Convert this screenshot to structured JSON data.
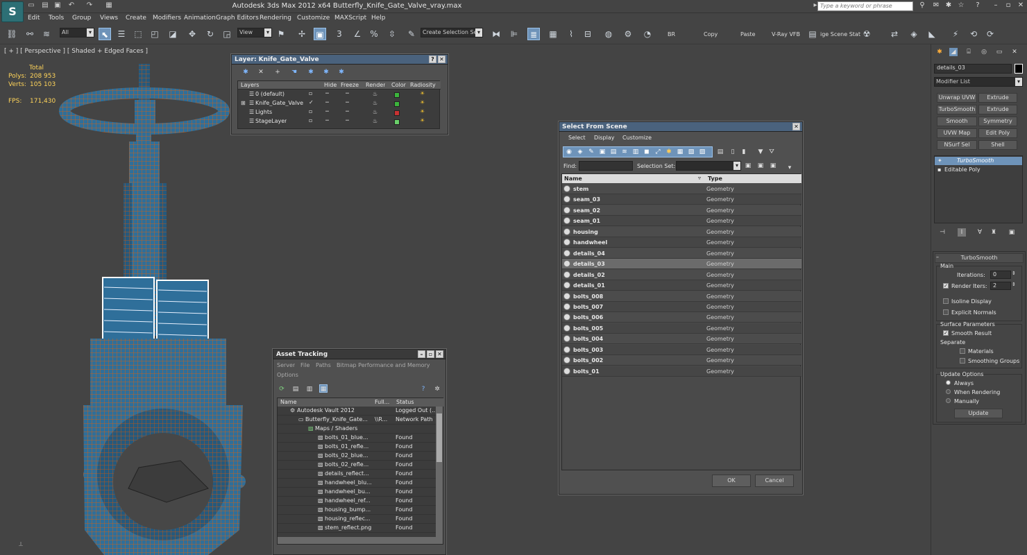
{
  "app": {
    "title": "Autodesk 3ds Max  2012 x64     Butterfly_Knife_Gate_Valve_vray.max",
    "search_placeholder": "Type a keyword or phrase",
    "logo": "S"
  },
  "menu": [
    "Edit",
    "Tools",
    "Group",
    "Views",
    "Create",
    "Modifiers",
    "Animation",
    "Graph Editors",
    "Rendering",
    "Customize",
    "MAXScript",
    "Help"
  ],
  "toolbar": {
    "filter": "All",
    "view": "View",
    "snap_labels": [
      "3",
      "%"
    ],
    "selection_set": "Create Selection Se",
    "text_buttons": [
      "BR",
      "Copy",
      "Paste",
      "V-Ray VFB",
      "ige Scene Stat"
    ]
  },
  "viewport": {
    "label": "[ + ] [ Perspective ] [ Shaded + Edged Faces ]",
    "stats": {
      "total": "Total",
      "polys_label": "Polys:",
      "polys": "208 953",
      "verts_label": "Verts:",
      "verts": "105 103",
      "fps_label": "FPS:",
      "fps": "171,430"
    }
  },
  "layer_dialog": {
    "title": "Layer: Knife_Gate_Valve",
    "columns": [
      "Layers",
      "Hide",
      "Freeze",
      "Render",
      "Color",
      "Radiosity"
    ],
    "rows": [
      {
        "name": "0 (default)",
        "color": "#3cb43c"
      },
      {
        "name": "Knife_Gate_Valve",
        "color": "#3cb43c"
      },
      {
        "name": "Lights",
        "color": "#c83232"
      },
      {
        "name": "StageLayer",
        "color": "#6ad06a"
      }
    ]
  },
  "asset_tracking": {
    "title": "Asset Tracking",
    "menu": [
      "Server",
      "File",
      "Paths",
      "Bitmap Performance and Memory"
    ],
    "menu2": "Options",
    "columns": [
      "Name",
      "Full...",
      "Status"
    ],
    "rows": [
      {
        "name": "Autodesk Vault 2012",
        "full": "",
        "status": "Logged Out (..."
      },
      {
        "name": "Butterfly_Knife_Gate...",
        "full": "\\\\R...",
        "status": "Network Path"
      },
      {
        "name": "Maps / Shaders",
        "full": "",
        "status": ""
      },
      {
        "name": "bolts_01_blue...",
        "full": "",
        "status": "Found"
      },
      {
        "name": "bolts_01_refle...",
        "full": "",
        "status": "Found"
      },
      {
        "name": "bolts_02_blue...",
        "full": "",
        "status": "Found"
      },
      {
        "name": "bolts_02_refle...",
        "full": "",
        "status": "Found"
      },
      {
        "name": "details_reflect...",
        "full": "",
        "status": "Found"
      },
      {
        "name": "handwheel_blu...",
        "full": "",
        "status": "Found"
      },
      {
        "name": "handwheel_bu...",
        "full": "",
        "status": "Found"
      },
      {
        "name": "handwheel_ref...",
        "full": "",
        "status": "Found"
      },
      {
        "name": "housing_bump...",
        "full": "",
        "status": "Found"
      },
      {
        "name": "housing_reflec...",
        "full": "",
        "status": "Found"
      },
      {
        "name": "stem_reflect.png",
        "full": "",
        "status": "Found"
      }
    ]
  },
  "select_scene": {
    "title": "Select From Scene",
    "menu": [
      "Select",
      "Display",
      "Customize"
    ],
    "find_label": "Find:",
    "selset_label": "Selection Set:",
    "columns": [
      "Name",
      "Type"
    ],
    "rows": [
      {
        "name": "stem",
        "type": "Geometry"
      },
      {
        "name": "seam_03",
        "type": "Geometry"
      },
      {
        "name": "seam_02",
        "type": "Geometry"
      },
      {
        "name": "seam_01",
        "type": "Geometry"
      },
      {
        "name": "housing",
        "type": "Geometry"
      },
      {
        "name": "handwheel",
        "type": "Geometry"
      },
      {
        "name": "details_04",
        "type": "Geometry"
      },
      {
        "name": "details_03",
        "type": "Geometry",
        "selected": true
      },
      {
        "name": "details_02",
        "type": "Geometry"
      },
      {
        "name": "details_01",
        "type": "Geometry"
      },
      {
        "name": "bolts_008",
        "type": "Geometry"
      },
      {
        "name": "bolts_007",
        "type": "Geometry"
      },
      {
        "name": "bolts_006",
        "type": "Geometry"
      },
      {
        "name": "bolts_005",
        "type": "Geometry"
      },
      {
        "name": "bolts_004",
        "type": "Geometry"
      },
      {
        "name": "bolts_003",
        "type": "Geometry"
      },
      {
        "name": "bolts_002",
        "type": "Geometry"
      },
      {
        "name": "bolts_01",
        "type": "Geometry"
      }
    ],
    "ok": "OK",
    "cancel": "Cancel"
  },
  "command_panel": {
    "object_name": "details_03",
    "modifier_list": "Modifier List",
    "buttons": [
      "Unwrap UVW",
      "Extrude",
      "TurboSmooth",
      "Extrude",
      "Smooth",
      "Symmetry",
      "UVW Map",
      "Edit Poly",
      "NSurf Sel",
      "Shell"
    ],
    "stack": [
      "TurboSmooth",
      "Editable Poly"
    ],
    "rollout": {
      "title": "TurboSmooth",
      "main": "Main",
      "iterations_label": "Iterations:",
      "iterations": "0",
      "render_iters_label": "Render Iters:",
      "render_iters": "2",
      "isoline": "Isoline Display",
      "explicit": "Explicit Normals",
      "surface": "Surface Parameters",
      "smooth_result": "Smooth Result",
      "separate": "Separate",
      "materials": "Materials",
      "smoothing_groups": "Smoothing Groups",
      "update_options": "Update Options",
      "always": "Always",
      "when_rendering": "When Rendering",
      "manually": "Manually",
      "update": "Update"
    }
  }
}
